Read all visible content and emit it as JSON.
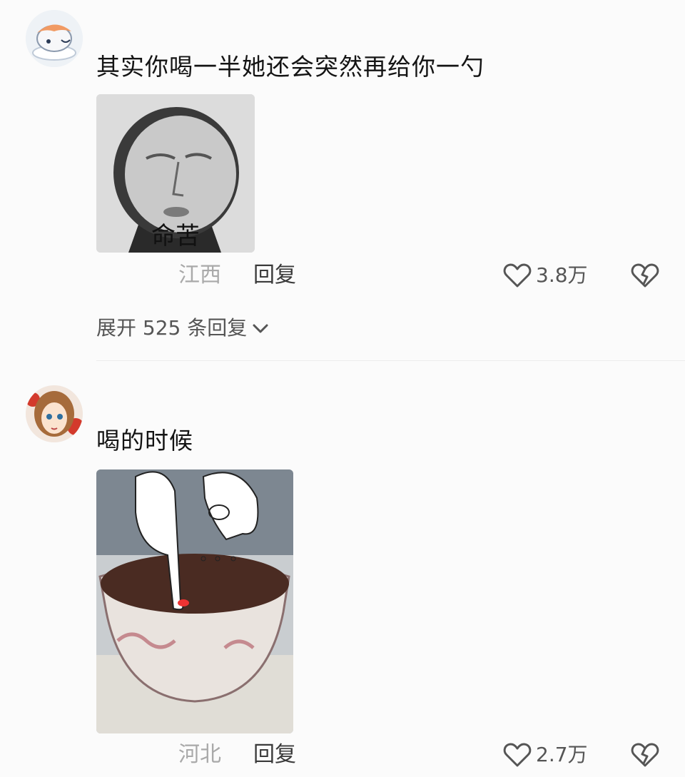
{
  "comments": [
    {
      "text": "其实你喝一半她还会突然再给你一勺",
      "image": {
        "caption": "命苦"
      },
      "location": "江西",
      "reply_label": "回复",
      "likes": "3.8万",
      "expand_label": "展开 525 条回复"
    },
    {
      "text": "喝的时候",
      "location": "河北",
      "reply_label": "回复",
      "likes": "2.7万"
    }
  ],
  "icons": {
    "like": "heart-outline-icon",
    "dislike": "broken-heart-icon",
    "expand": "chevron-down-icon"
  },
  "colors": {
    "text": "#141414",
    "meta_gray": "#a9a9a9",
    "reply_dark": "#3a3a3a",
    "like_gray": "#555555",
    "divider": "#ececec"
  }
}
